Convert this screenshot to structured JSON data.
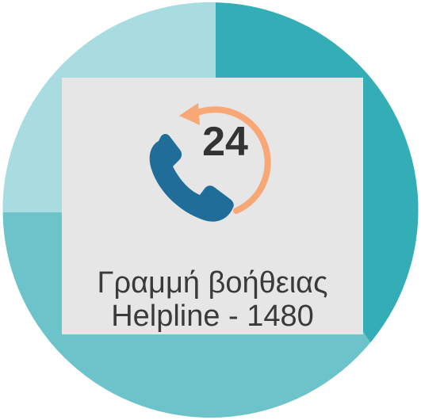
{
  "helpline": {
    "badge_number": "24",
    "title_greek": "Γραμμή βοήθειας",
    "title_english": "Helpline - 1480"
  },
  "icons": {
    "phone": "phone-handset-icon",
    "arrow": "circular-arrow-icon"
  },
  "colors": {
    "circle_light": "#a9dce0",
    "circle_mid": "#6cc3c9",
    "circle_dark": "#33aeb7",
    "card_background": "#e6e6e6",
    "phone_blue": "#1f6d98",
    "arrow_orange": "#f8a777",
    "text": "#3a3a3a"
  }
}
